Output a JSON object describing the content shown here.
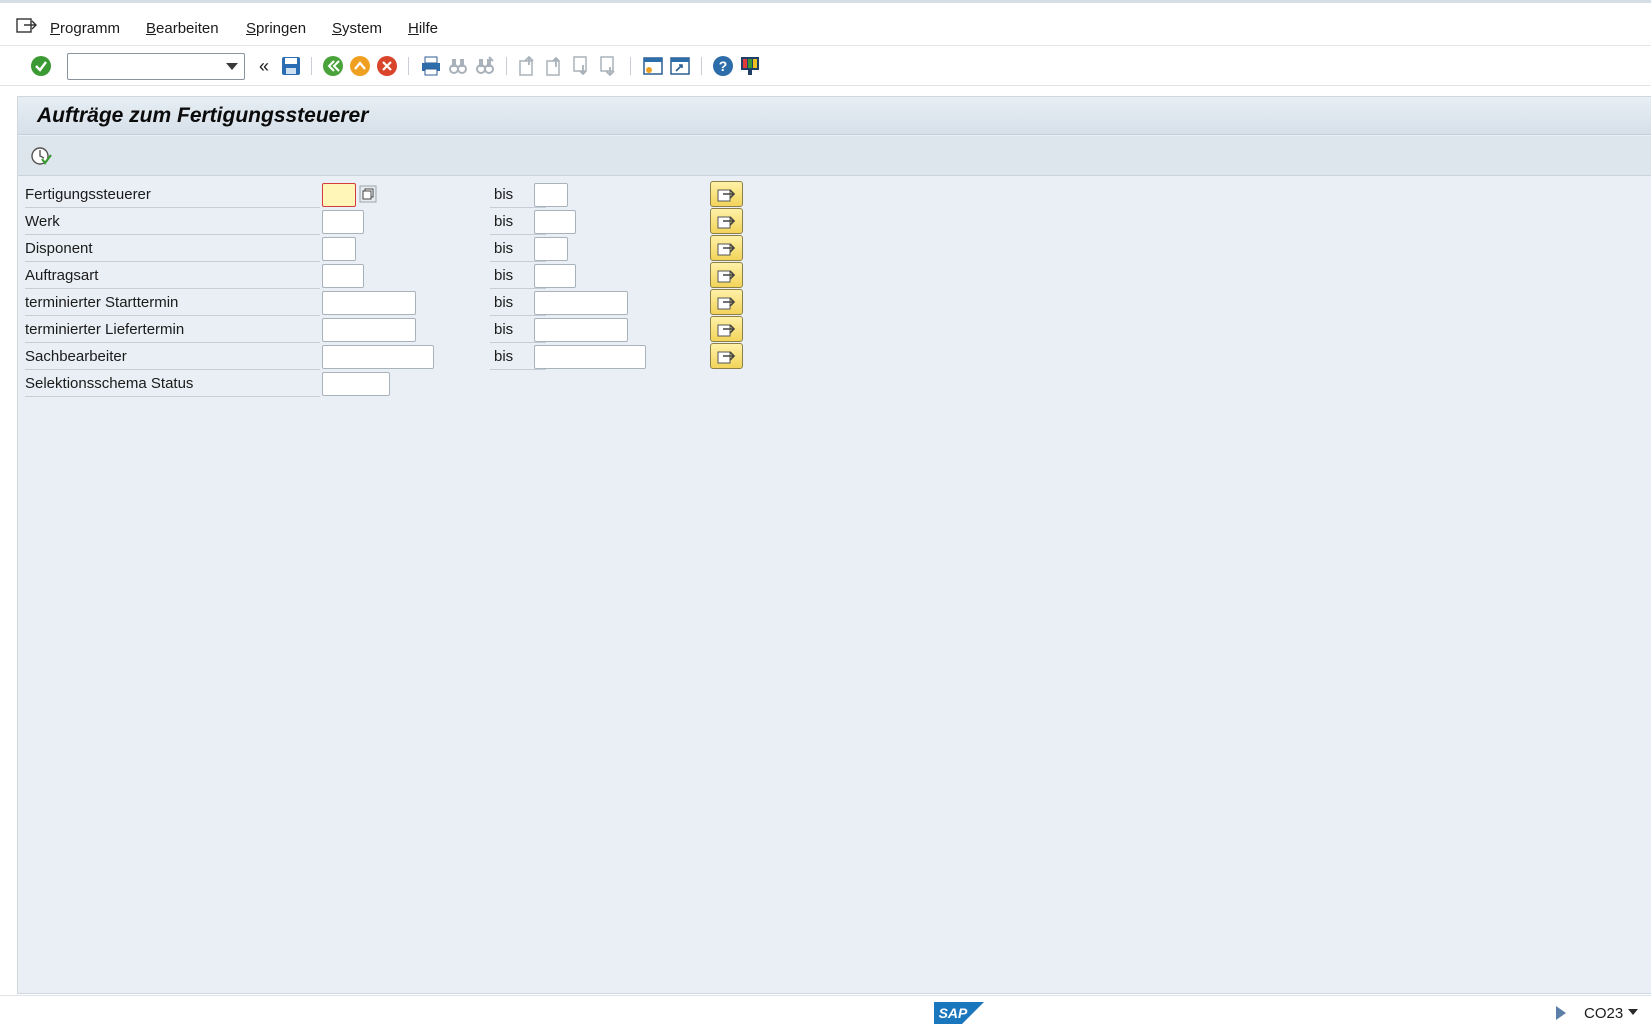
{
  "menu": {
    "items": [
      "Programm",
      "Bearbeiten",
      "Springen",
      "System",
      "Hilfe"
    ]
  },
  "toolbar": {
    "command_value": "",
    "back_double": "«"
  },
  "screen": {
    "title": "Aufträge zum Fertigungssteuerer"
  },
  "form": {
    "bis_label": "bis",
    "rows": [
      {
        "label": "Fertigungssteuerer",
        "from": "",
        "to": ""
      },
      {
        "label": "Werk",
        "from": "",
        "to": ""
      },
      {
        "label": "Disponent",
        "from": "",
        "to": ""
      },
      {
        "label": "Auftragsart",
        "from": "",
        "to": ""
      },
      {
        "label": "terminierter Starttermin",
        "from": "",
        "to": ""
      },
      {
        "label": "terminierter Liefertermin",
        "from": "",
        "to": ""
      },
      {
        "label": "Sachbearbeiter",
        "from": "",
        "to": ""
      },
      {
        "label": "Selektionsschema Status",
        "from": ""
      }
    ]
  },
  "status": {
    "transaction": "CO23",
    "logo_text": "SAP"
  },
  "colors": {
    "background": "#e9eff4",
    "focus_field": "#fff6b8",
    "multi_button": "#f2d45a",
    "sap_blue": "#1a76bd"
  }
}
